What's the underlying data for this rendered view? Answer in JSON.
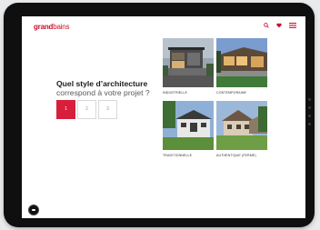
{
  "brand": {
    "bold": "grand",
    "light": "bains"
  },
  "header": {
    "icons": [
      "search-icon",
      "heart-icon",
      "menu-icon"
    ],
    "accent_color": "#c8102e"
  },
  "question": {
    "line1": "Quel style d’architecture",
    "line2": "correspond à votre projet ?"
  },
  "steps": [
    {
      "label": "1",
      "active": true
    },
    {
      "label": "2",
      "active": false
    },
    {
      "label": "3",
      "active": false
    }
  ],
  "styles": [
    {
      "label": "INDUSTRIELLE"
    },
    {
      "label": "CONTEMPORAINE"
    },
    {
      "label": "TRADITIONNELLE"
    },
    {
      "label": "AUTHENTIQUE (FERME)"
    }
  ],
  "chat_widget": {
    "icon": "chat-icon"
  }
}
